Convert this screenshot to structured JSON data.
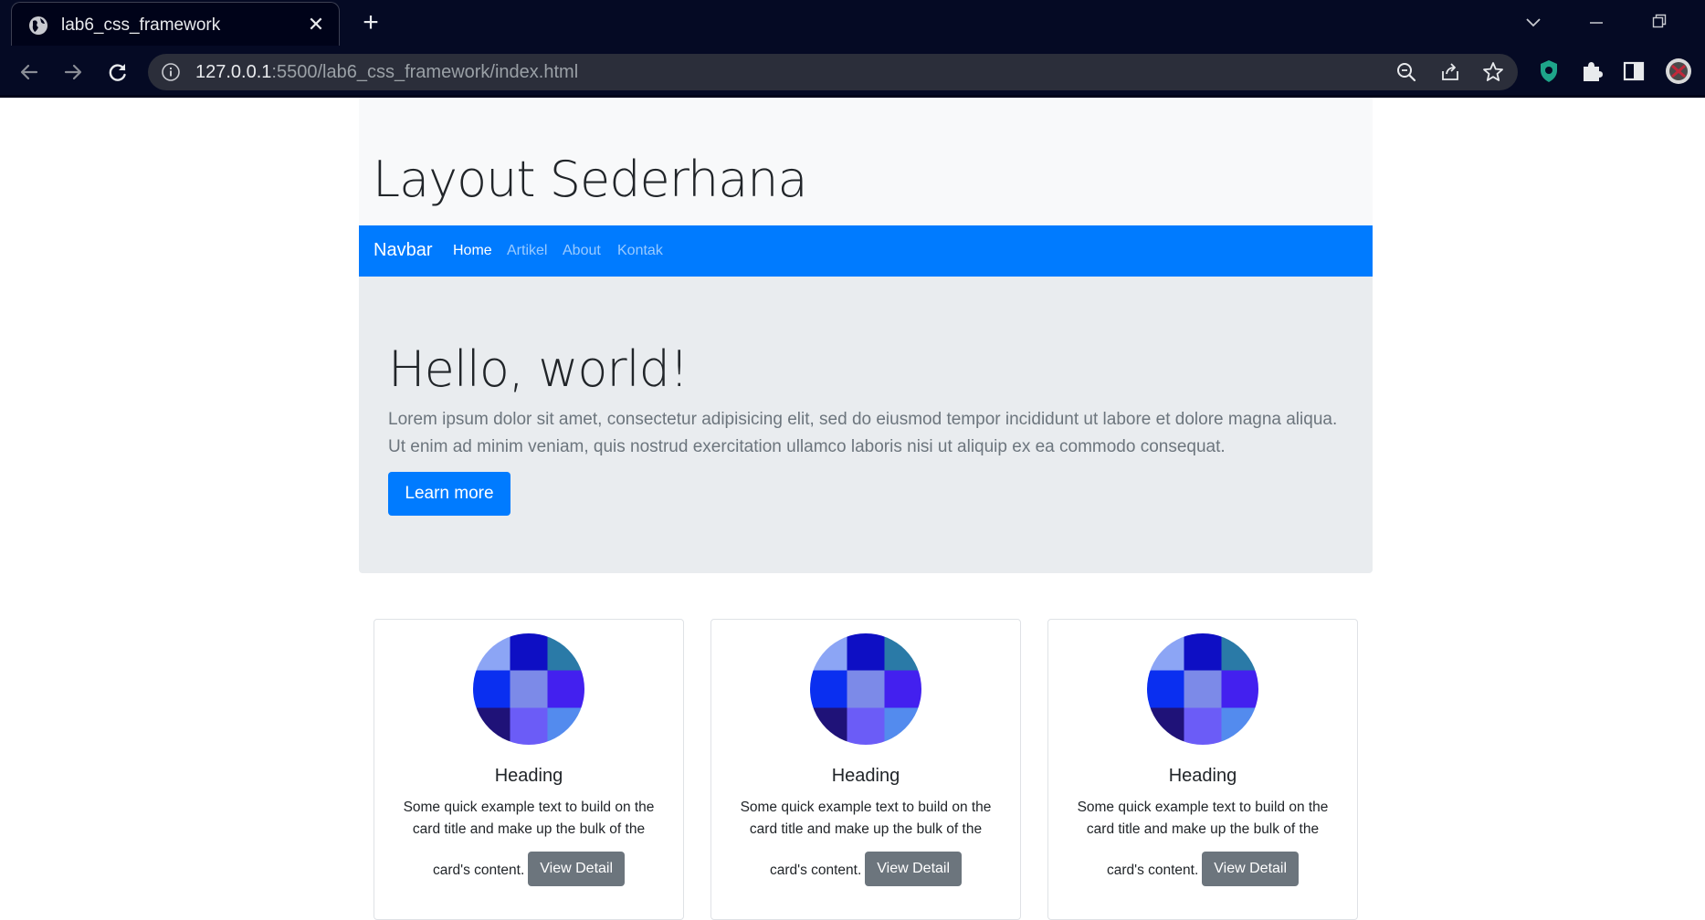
{
  "browser": {
    "tab_title": "lab6_css_framework",
    "url_host": "127.0.0.1",
    "url_rest": ":5500/lab6_css_framework/index.html"
  },
  "header": {
    "title": "Layout Sederhana"
  },
  "navbar": {
    "brand": "Navbar",
    "links": [
      "Home",
      "Artikel",
      "About",
      "Kontak"
    ],
    "active": "Home",
    "color": "#007bff"
  },
  "jumbotron": {
    "heading": "Hello, world!",
    "lead": "Lorem ipsum dolor sit amet, consectetur adipisicing elit, sed do eiusmod tempor incididunt ut labore et dolore magna aliqua. Ut enim ad minim veniam, quis nostrud exercitation ullamco laboris nisi ut aliquip ex ea commodo consequat.",
    "button": "Learn more"
  },
  "cards": [
    {
      "title": "Heading",
      "text": "Some quick example text to build on the card title and make up the bulk of the",
      "text_tail": "card's content.",
      "button": "View Detail"
    },
    {
      "title": "Heading",
      "text": "Some quick example text to build on the card title and make up the bulk of the",
      "text_tail": "card's content.",
      "button": "View Detail"
    },
    {
      "title": "Heading",
      "text": "Some quick example text to build on the card title and make up the bulk of the",
      "text_tail": "card's content.",
      "button": "View Detail"
    }
  ],
  "avatar_colors": [
    "#8ca5f5",
    "#0e0fc4",
    "#2a7aa7",
    "#0a2ff0",
    "#7c8ae8",
    "#4320ef",
    "#1f1278",
    "#6b5cf7",
    "#538bee"
  ]
}
